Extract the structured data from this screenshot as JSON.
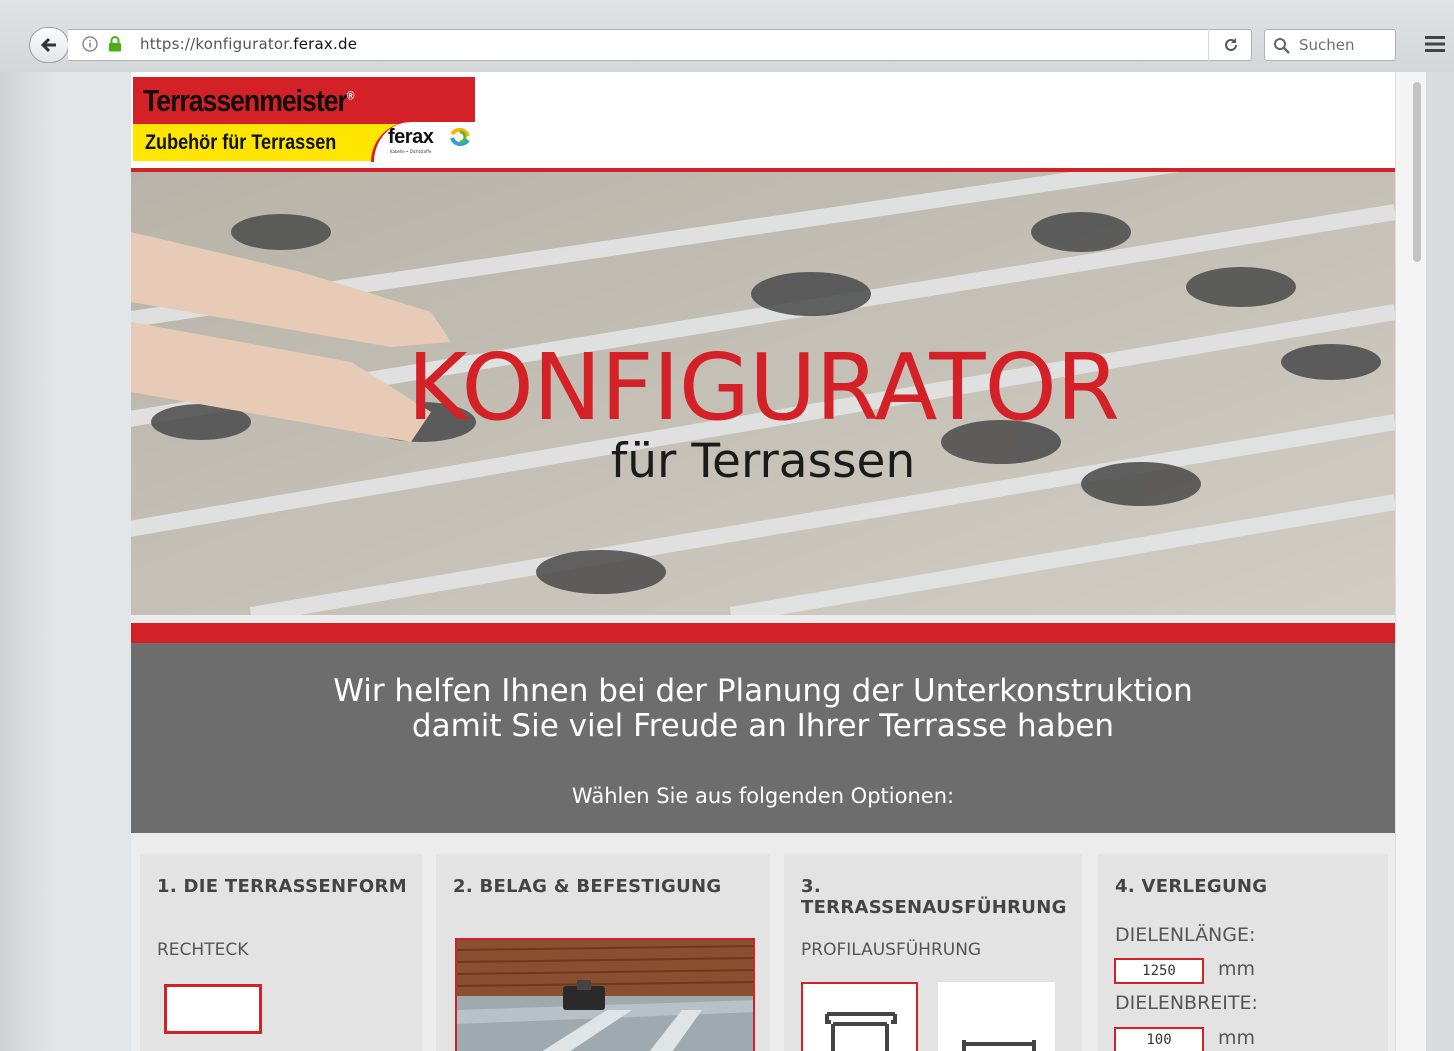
{
  "browser": {
    "url_prefix": "https://konfigurator.",
    "url_domain": "ferax.de",
    "search_placeholder": "Suchen"
  },
  "header": {
    "logo_title": "Terrassenmeister",
    "logo_registered": "®",
    "logo_subtitle": "Zubehör für Terrassen",
    "logo_brand": "ferax",
    "logo_brand_tagline": "Kabelle • Dichtstoffe"
  },
  "hero": {
    "title": "KONFIGURATOR",
    "subtitle": "für Terrassen"
  },
  "intro": {
    "line1": "Wir helfen Ihnen bei der Planung der Unterkonstruktion",
    "line2": "damit Sie viel Freude an Ihrer Terrasse haben",
    "prompt": "Wählen Sie aus folgenden Optionen:"
  },
  "cards": [
    {
      "title": "1. DIE TERRASSENFORM",
      "label": "RECHTECK"
    },
    {
      "title": "2. BELAG & BEFESTIGUNG"
    },
    {
      "title": "3. TERRASSENAUSFÜHRUNG",
      "label": "PROFILAUSFÜHRUNG"
    },
    {
      "title": "4. VERLEGUNG",
      "length_label": "DIELENLÄNGE:",
      "length_value": "1250",
      "width_label": "DIELENBREITE:",
      "width_value": "100",
      "unit": "mm"
    }
  ],
  "colors": {
    "accent": "#d42027",
    "band": "#6d6d6d",
    "yellow": "#ffe600"
  }
}
